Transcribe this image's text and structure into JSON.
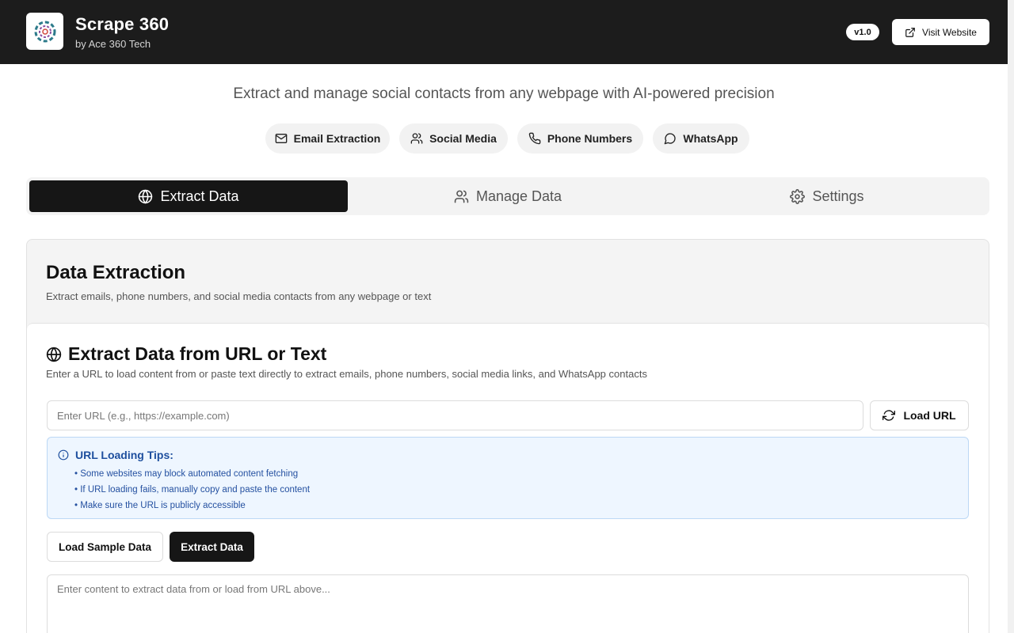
{
  "header": {
    "title": "Scrape 360",
    "subtitle": "by Ace 360 Tech",
    "version": "v1.0",
    "visit_label": "Visit Website",
    "logo_icon": "circular-logo-icon"
  },
  "tagline": "Extract and manage social contacts from any webpage with AI-powered precision",
  "features": [
    {
      "label": "Email Extraction",
      "icon": "mail-icon"
    },
    {
      "label": "Social Media",
      "icon": "users-icon"
    },
    {
      "label": "Phone Numbers",
      "icon": "phone-icon"
    },
    {
      "label": "WhatsApp",
      "icon": "message-circle-icon"
    }
  ],
  "tabs": [
    {
      "label": "Extract Data",
      "icon": "globe-icon",
      "active": true
    },
    {
      "label": "Manage Data",
      "icon": "users-icon",
      "active": false
    },
    {
      "label": "Settings",
      "icon": "gear-icon",
      "active": false
    }
  ],
  "card": {
    "title": "Data Extraction",
    "description": "Extract emails, phone numbers, and social media contacts from any webpage or text"
  },
  "extract": {
    "title": "Extract Data from URL or Text",
    "description": "Enter a URL to load content from or paste text directly to extract emails, phone numbers, social media links, and WhatsApp contacts",
    "url_placeholder": "Enter URL (e.g., https://example.com)",
    "url_value": "",
    "load_label": "Load URL",
    "tips_title": "URL Loading Tips:",
    "tips": [
      "Some websites may block automated content fetching",
      "If URL loading fails, manually copy and paste the content",
      "Make sure the URL is publicly accessible"
    ],
    "sample_label": "Load Sample Data",
    "extract_label": "Extract Data",
    "content_placeholder": "Enter content to extract data from or load from URL above..."
  },
  "colors": {
    "header_bg": "#1c1c1c",
    "active_tab_bg": "#161616",
    "tips_bg": "#eef6ff",
    "tips_text": "#2450a0"
  }
}
